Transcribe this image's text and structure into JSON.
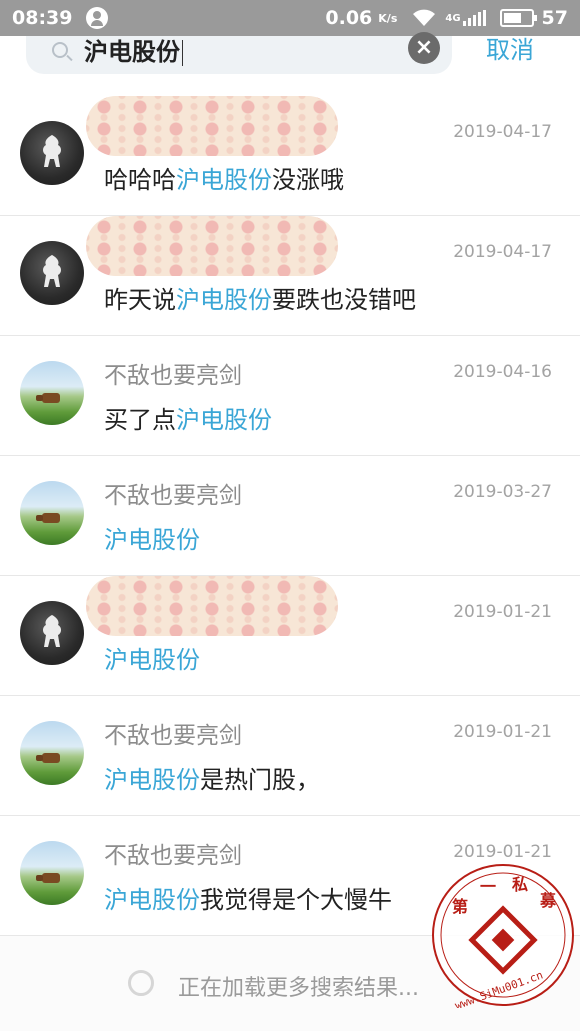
{
  "status_bar": {
    "time": "08:39",
    "speed": "0.06",
    "speed_unit": "K/s",
    "network": "4G",
    "battery": "57"
  },
  "search": {
    "query": "沪电股份",
    "cancel_label": "取消",
    "clear_icon": "close-icon"
  },
  "results": [
    {
      "name": "",
      "name_hidden": true,
      "avatar": "horse",
      "date": "2019-04-17",
      "pre": "哈哈哈",
      "hl": "沪电股份",
      "post": "没涨哦"
    },
    {
      "name": "",
      "name_hidden": true,
      "avatar": "horse",
      "date": "2019-04-17",
      "pre": "昨天说",
      "hl": "沪电股份",
      "post": "要跌也没错吧"
    },
    {
      "name": "不敌也要亮剑",
      "name_hidden": false,
      "avatar": "meadow",
      "date": "2019-04-16",
      "pre": "买了点",
      "hl": "沪电股份",
      "post": ""
    },
    {
      "name": "不敌也要亮剑",
      "name_hidden": false,
      "avatar": "meadow",
      "date": "2019-03-27",
      "pre": "",
      "hl": "沪电股份",
      "post": ""
    },
    {
      "name": "",
      "name_hidden": true,
      "avatar": "horse",
      "date": "2019-01-21",
      "pre": "",
      "hl": "沪电股份",
      "post": ""
    },
    {
      "name": "不敌也要亮剑",
      "name_hidden": false,
      "avatar": "meadow",
      "date": "2019-01-21",
      "pre": "",
      "hl": "沪电股份",
      "post": "是热门股，"
    },
    {
      "name": "不敌也要亮剑",
      "name_hidden": false,
      "avatar": "meadow",
      "date": "2019-01-21",
      "pre": "",
      "hl": "沪电股份",
      "post": "我觉得是个大慢牛"
    }
  ],
  "loading": {
    "text": "正在加载更多搜索结果..."
  },
  "watermark": {
    "chars": [
      "第",
      "一",
      "私",
      "募"
    ],
    "url": "www.SiMu001.cn"
  },
  "colors": {
    "accent": "#3aa6d6",
    "status_bar": "#9a9a9a",
    "watermark": "#b81e16"
  }
}
